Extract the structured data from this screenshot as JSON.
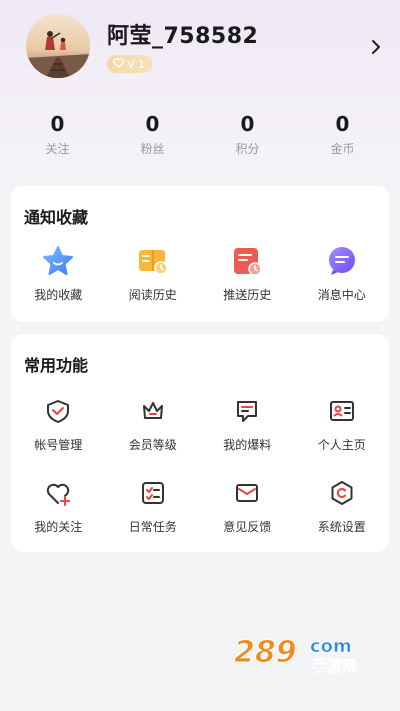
{
  "profile": {
    "username": "阿莹_758582",
    "level": "V 1"
  },
  "stats": [
    {
      "value": "0",
      "label": "关注"
    },
    {
      "value": "0",
      "label": "粉丝"
    },
    {
      "value": "0",
      "label": "积分"
    },
    {
      "value": "0",
      "label": "金币"
    }
  ],
  "notifications": {
    "title": "通知收藏",
    "items": [
      {
        "label": "我的收藏",
        "icon": "star-icon"
      },
      {
        "label": "阅读历史",
        "icon": "book-clock-icon"
      },
      {
        "label": "推送历史",
        "icon": "push-history-icon"
      },
      {
        "label": "消息中心",
        "icon": "chat-bubble-icon"
      }
    ]
  },
  "functions": {
    "title": "常用功能",
    "items": [
      {
        "label": "帐号管理",
        "icon": "account-icon"
      },
      {
        "label": "会员等级",
        "icon": "crown-icon"
      },
      {
        "label": "我的爆料",
        "icon": "message-icon"
      },
      {
        "label": "个人主页",
        "icon": "id-card-icon"
      },
      {
        "label": "我的关注",
        "icon": "heart-plus-icon"
      },
      {
        "label": "日常任务",
        "icon": "task-list-icon"
      },
      {
        "label": "意见反馈",
        "icon": "mail-icon"
      },
      {
        "label": "系统设置",
        "icon": "settings-hex-icon"
      }
    ]
  },
  "watermark": {
    "number": "289",
    "suffix": "com",
    "text": "手游网"
  },
  "colors": {
    "accent": "#e8463f",
    "background": "#f4f4f7"
  }
}
